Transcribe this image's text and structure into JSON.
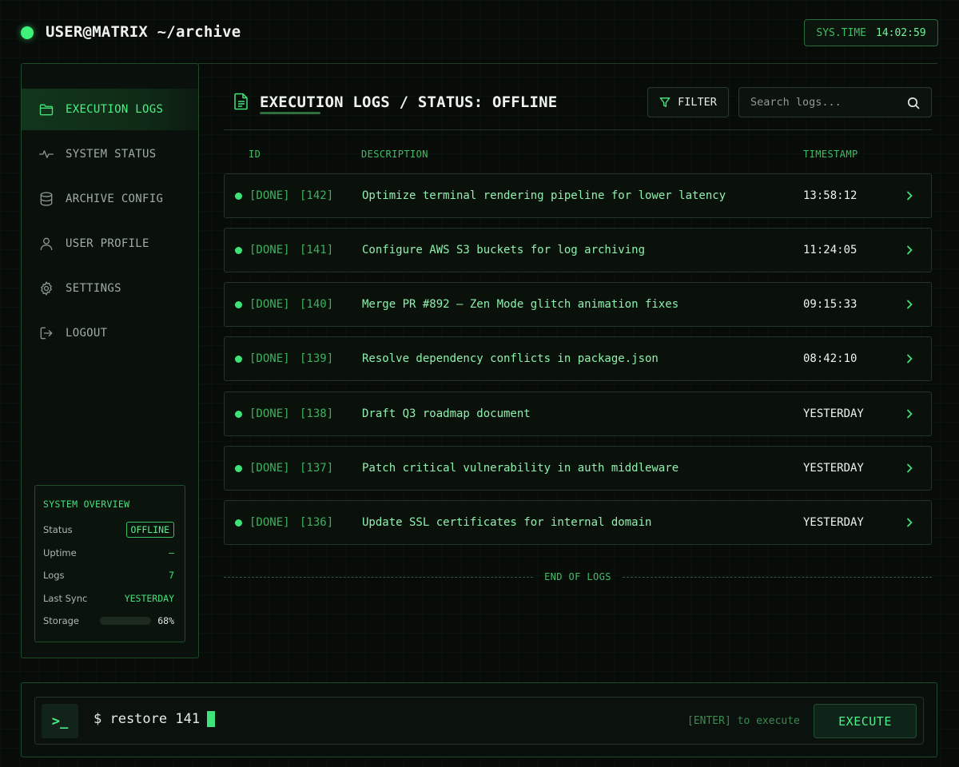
{
  "header": {
    "title": "USER@MATRIX ~/archive",
    "systime_label": "SYS.TIME",
    "systime_value": "14:02:59"
  },
  "sidebar": {
    "items": [
      {
        "label": "EXECUTION LOGS",
        "icon": "folder-icon",
        "active": true
      },
      {
        "label": "SYSTEM STATUS",
        "icon": "activity-icon",
        "active": false
      },
      {
        "label": "ARCHIVE CONFIG",
        "icon": "database-icon",
        "active": false
      },
      {
        "label": "USER PROFILE",
        "icon": "user-icon",
        "active": false
      },
      {
        "label": "SETTINGS",
        "icon": "gear-icon",
        "active": false
      },
      {
        "label": "LOGOUT",
        "icon": "logout-icon",
        "active": false
      }
    ],
    "overview": {
      "title": "SYSTEM OVERVIEW",
      "status_label": "Status",
      "status_value": "OFFLINE",
      "uptime_label": "Uptime",
      "uptime_value": "—",
      "logs_label": "Logs",
      "logs_value": "7",
      "last_sync_label": "Last Sync",
      "last_sync_value": "YESTERDAY",
      "storage_label": "Storage",
      "storage_value": "68%",
      "storage_percent": 68
    }
  },
  "main": {
    "title": "EXECUTION LOGS / STATUS: OFFLINE",
    "filter_label": "FILTER",
    "search_placeholder": "Search logs...",
    "columns": {
      "id": "ID",
      "description": "DESCRIPTION",
      "timestamp": "TIMESTAMP"
    },
    "rows": [
      {
        "state": "[DONE]",
        "id": "[142]",
        "description": "Optimize terminal rendering pipeline for lower latency",
        "timestamp": "13:58:12"
      },
      {
        "state": "[DONE]",
        "id": "[141]",
        "description": "Configure AWS S3 buckets for log archiving",
        "timestamp": "11:24:05"
      },
      {
        "state": "[DONE]",
        "id": "[140]",
        "description": "Merge PR #892 — Zen Mode glitch animation fixes",
        "timestamp": "09:15:33"
      },
      {
        "state": "[DONE]",
        "id": "[139]",
        "description": "Resolve dependency conflicts in package.json",
        "timestamp": "08:42:10"
      },
      {
        "state": "[DONE]",
        "id": "[138]",
        "description": "Draft Q3 roadmap document",
        "timestamp": "YESTERDAY"
      },
      {
        "state": "[DONE]",
        "id": "[137]",
        "description": "Patch critical vulnerability in auth middleware",
        "timestamp": "YESTERDAY"
      },
      {
        "state": "[DONE]",
        "id": "[136]",
        "description": "Update SSL certificates for internal domain",
        "timestamp": "YESTERDAY"
      }
    ],
    "end_label": "END OF LOGS"
  },
  "command": {
    "prompt_icon": ">_",
    "text": "$ restore 141",
    "hint": "[ENTER] to execute",
    "execute_label": "EXECUTE"
  },
  "colors": {
    "accent": "#3fe378",
    "background": "#080c09",
    "border": "#1f4a2a"
  }
}
